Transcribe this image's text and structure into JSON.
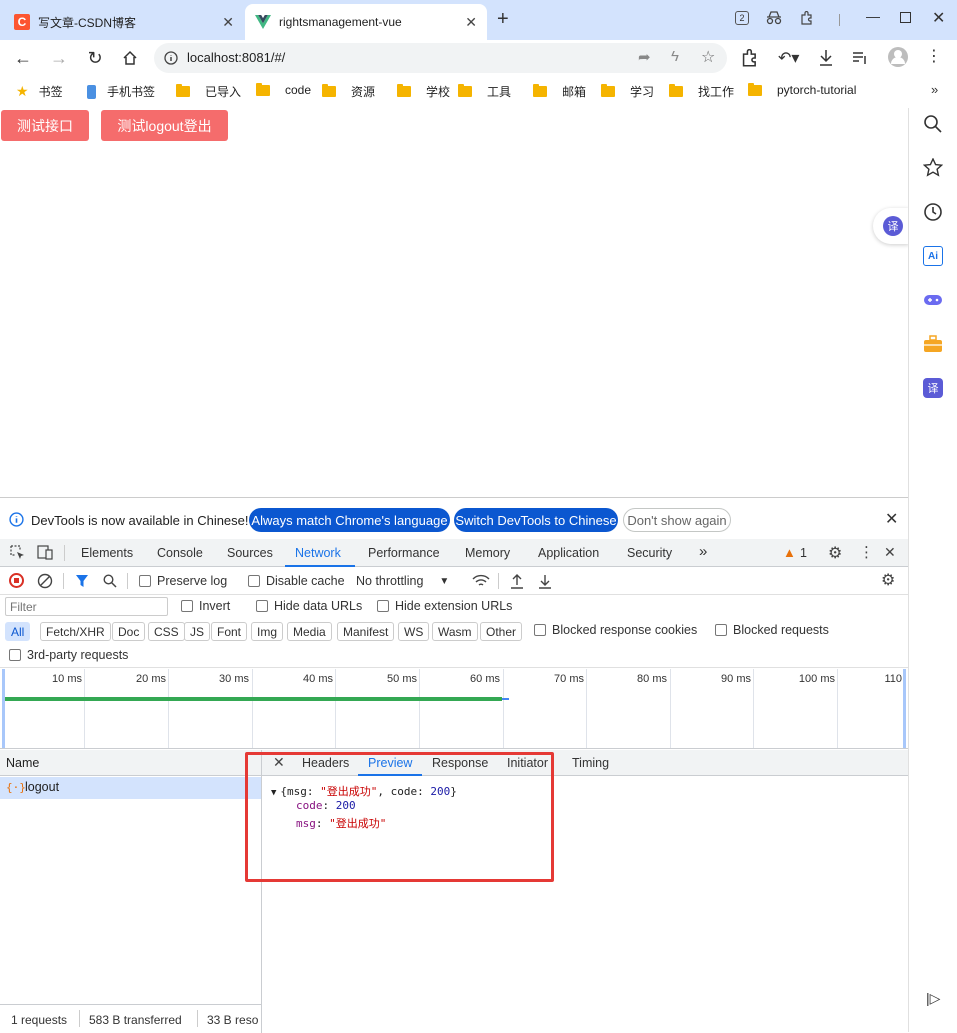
{
  "browser": {
    "tabs": [
      {
        "icon": "csdn-logo",
        "title": "写文章-CSDN博客",
        "active": false
      },
      {
        "icon": "vue-logo",
        "title": "rightsmanagement-vue",
        "active": true
      }
    ],
    "new_tab": "+",
    "tab_counter": "2",
    "url": "localhost:8081/#/",
    "bookmarks": [
      {
        "icon": "star-icon",
        "label": "书签"
      },
      {
        "icon": "phone-icon",
        "label": "手机书签"
      },
      {
        "icon": "folder-icon",
        "label": "已导入"
      },
      {
        "icon": "folder-icon",
        "label": "code"
      },
      {
        "icon": "folder-icon",
        "label": "资源"
      },
      {
        "icon": "folder-icon",
        "label": "学校"
      },
      {
        "icon": "folder-icon",
        "label": "工具"
      },
      {
        "icon": "folder-icon",
        "label": "邮箱"
      },
      {
        "icon": "folder-icon",
        "label": "学习"
      },
      {
        "icon": "folder-icon",
        "label": "找工作"
      },
      {
        "icon": "folder-icon",
        "label": "pytorch-tutorial"
      }
    ]
  },
  "page": {
    "btn_test_api": "测试接口",
    "btn_test_logout": "测试logout登出",
    "translate_badge": "译"
  },
  "devtools": {
    "banner": {
      "text": "DevTools is now available in Chinese!",
      "btn_match": "Always match Chrome's language",
      "btn_switch": "Switch DevTools to Chinese",
      "btn_dont_show": "Don't show again"
    },
    "tabs": [
      "Elements",
      "Console",
      "Sources",
      "Network",
      "Performance",
      "Memory",
      "Application",
      "Security"
    ],
    "active_tab": "Network",
    "warning_count": "1",
    "toolbar": {
      "preserve_log": "Preserve log",
      "disable_cache": "Disable cache",
      "throttling": "No throttling"
    },
    "filter": {
      "placeholder": "Filter",
      "invert": "Invert",
      "hide_data_urls": "Hide data URLs",
      "hide_extension_urls": "Hide extension URLs"
    },
    "type_filters": [
      "All",
      "Fetch/XHR",
      "Doc",
      "CSS",
      "JS",
      "Font",
      "Img",
      "Media",
      "Manifest",
      "WS",
      "Wasm",
      "Other"
    ],
    "blocked_response_cookies": "Blocked response cookies",
    "blocked_requests": "Blocked requests",
    "third_party": "3rd-party requests",
    "timeline_ticks": [
      "10 ms",
      "20 ms",
      "30 ms",
      "40 ms",
      "50 ms",
      "60 ms",
      "70 ms",
      "80 ms",
      "90 ms",
      "100 ms",
      "110"
    ],
    "requests": {
      "header": "Name",
      "items": [
        {
          "name": "logout"
        }
      ]
    },
    "detail_tabs": [
      "Headers",
      "Preview",
      "Response",
      "Initiator",
      "Timing"
    ],
    "active_detail_tab": "Preview",
    "preview": {
      "summary_prefix": "{msg: ",
      "summary_msg": "\"登出成功\"",
      "summary_mid": ", code: ",
      "summary_code": "200",
      "summary_suffix": "}",
      "code_key": "code",
      "code_value": "200",
      "msg_key": "msg",
      "msg_value": "\"登出成功\""
    },
    "status": {
      "requests": "1 requests",
      "transferred": "583 B transferred",
      "resources": "33 B reso"
    }
  },
  "colors": {
    "accent": "#1a73e8",
    "red_button": "#f56c6c",
    "highlight_box": "#e53935"
  }
}
